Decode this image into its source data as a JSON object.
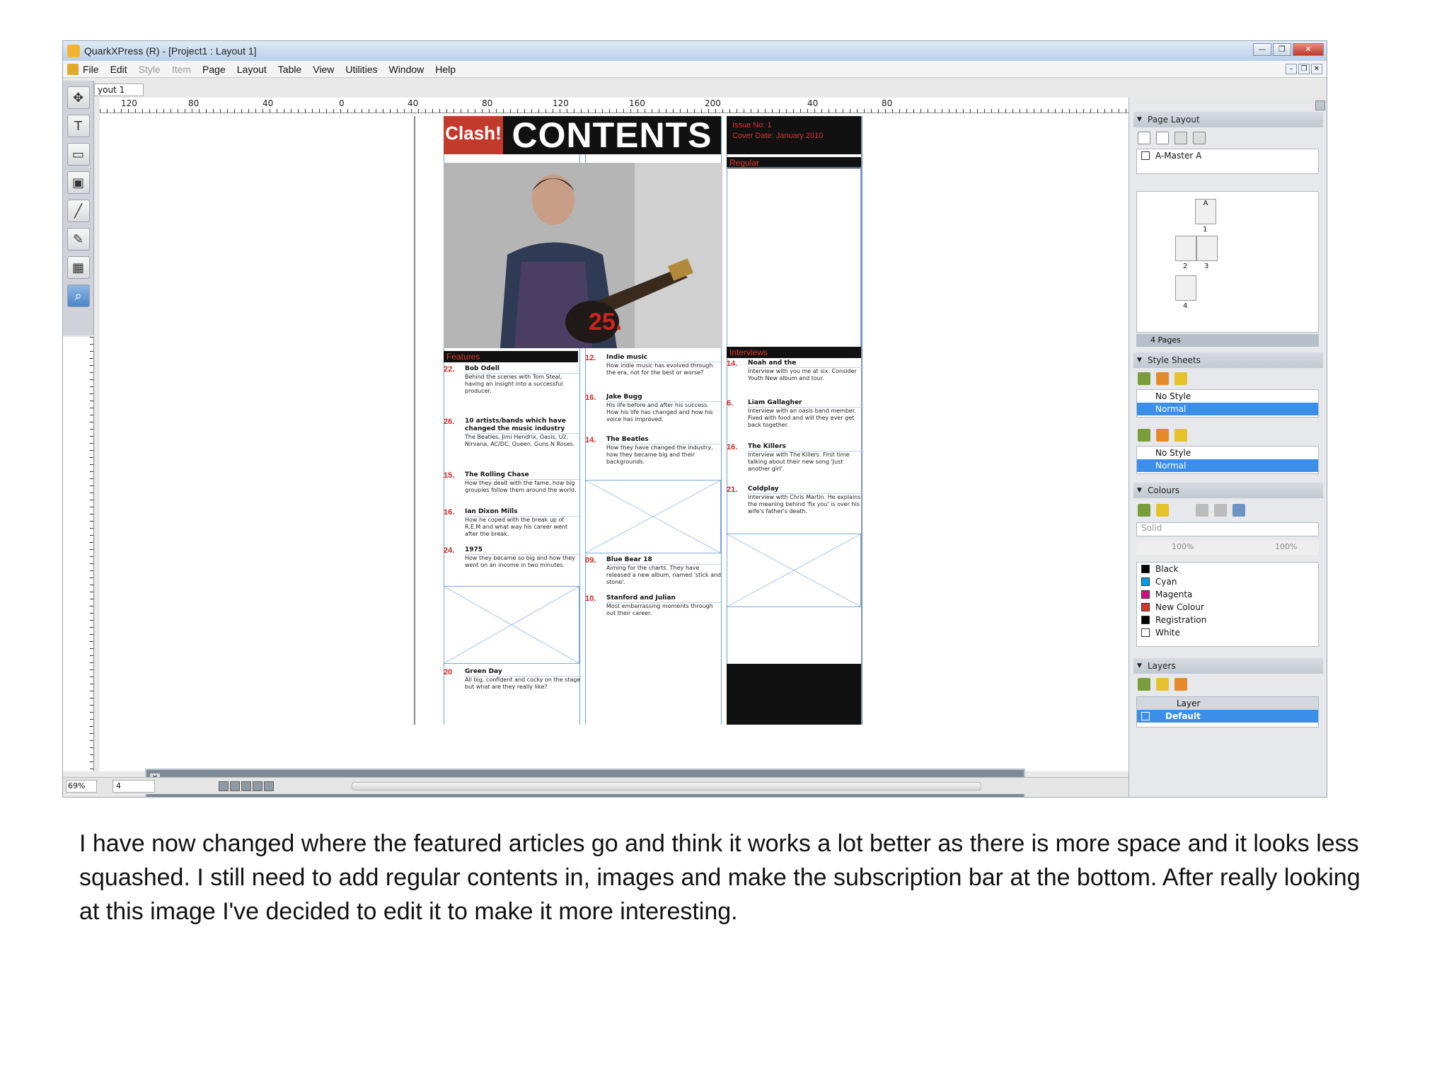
{
  "window": {
    "title": "QuarkXPress (R) - [Project1 : Layout 1]",
    "controls": [
      "—",
      "❐",
      "✕"
    ]
  },
  "menu": [
    {
      "label": "File",
      "enabled": true
    },
    {
      "label": "Edit",
      "enabled": true
    },
    {
      "label": "Style",
      "enabled": false
    },
    {
      "label": "Item",
      "enabled": false
    },
    {
      "label": "Page",
      "enabled": true
    },
    {
      "label": "Layout",
      "enabled": true
    },
    {
      "label": "Table",
      "enabled": true
    },
    {
      "label": "View",
      "enabled": true
    },
    {
      "label": "Utilities",
      "enabled": true
    },
    {
      "label": "Window",
      "enabled": true
    },
    {
      "label": "Help",
      "enabled": true
    }
  ],
  "doc_tab": "yout 1",
  "ruler_h_ticks": [
    "120",
    "80",
    "40",
    "0",
    "40",
    "80",
    "120",
    "160",
    "200",
    "40",
    "80"
  ],
  "page": {
    "logo": "Clash!",
    "title": "CONTENTS",
    "issue_no": "Issue No: 1",
    "cover_date": "Cover Date: January 2010",
    "photo_number": "25.",
    "sections": {
      "features": "Features",
      "regular": "Regular",
      "interviews": "Interviews"
    }
  },
  "features": [
    {
      "num": "22.",
      "head": "Bob Odell",
      "body": "Behind the scenes with Tom Steal, having an insight into a successful producer."
    },
    {
      "num": "26.",
      "head": "10 artists/bands which have changed the music industry",
      "body": "The Beatles, Jimi Hendrix, Oasis, U2, Nirvana, AC/DC, Queen, Guns N Roses."
    },
    {
      "num": "15.",
      "head": "The Rolling Chase",
      "body": "How they dealt with the fame, how big groupies follow them around the world."
    },
    {
      "num": "16.",
      "head": "Ian Dixon Mills",
      "body": "How he coped with the break up of R.E.M and what way his career went after the break."
    },
    {
      "num": "24.",
      "head": "1975",
      "body": "How they became so big and how they went on an income in two minutes."
    },
    {
      "num": "20",
      "head": "Green Day",
      "body": "All big, confident and cocky on the stage but what are they really like?"
    }
  ],
  "middle": [
    {
      "num": "12.",
      "head": "Indie music",
      "body": "How indie music has evolved through the era, not for the best or worse?"
    },
    {
      "num": "16.",
      "head": "Jake Bugg",
      "body": "His life before and after his success. How his life has changed and how his voice has improved."
    },
    {
      "num": "14.",
      "head": "The Beatles",
      "body": "How they have changed the industry, how they became big and their backgrounds."
    },
    {
      "num": "09.",
      "head": "Blue Bear 18",
      "body": "Aiming for the charts. They have released a new album, named 'stick and stone'."
    },
    {
      "num": "10.",
      "head": "Stanford and Julian",
      "body": "Most embarrassing moments through out their career."
    }
  ],
  "interviews": [
    {
      "num": "14.",
      "head": "Noah and the",
      "body": "Interview with you me at six. Consider Youth New album and tour."
    },
    {
      "num": "6.",
      "head": "Liam Gallagher",
      "body": "Interview with an oasis band member. Fixed with food and will they ever get back together."
    },
    {
      "num": "16.",
      "head": "The Killers",
      "body": "Interview with The Killers. First time talking about their new song 'Just another girl'."
    },
    {
      "num": "21.",
      "head": "Coldplay",
      "body": "Interview with Chris Martin. He explains the meaning behind 'fix you' is over his wife's father's death."
    }
  ],
  "status": {
    "zoom": "69%",
    "page": "4"
  },
  "palettes": {
    "page_layout": {
      "title": "Page Layout",
      "master": "A-Master A",
      "pages_count": "4 Pages"
    },
    "style_sheets": {
      "title": "Style Sheets",
      "para": [
        "No Style",
        "Normal"
      ],
      "char": [
        "No Style",
        "Normal"
      ]
    },
    "colours": {
      "title": "Colours",
      "fill": "Solid",
      "shade": "100%",
      "opacity": "100%",
      "items": [
        {
          "name": "Black",
          "color": "#000000"
        },
        {
          "name": "Cyan",
          "color": "#00a0e0"
        },
        {
          "name": "Magenta",
          "color": "#d0117d"
        },
        {
          "name": "New Colour",
          "color": "#d8362a"
        },
        {
          "name": "Registration",
          "color": "#000000"
        },
        {
          "name": "White",
          "color": "#ffffff"
        }
      ]
    },
    "layers": {
      "title": "Layers",
      "header": "Layer",
      "default": "Default"
    }
  },
  "caption": "I have now changed where the featured articles go and think it works a lot better as there is more space and it looks less squashed. I still need to add regular contents in, images and make the subscription bar at the bottom. After really looking at this image I've decided to edit it to make it more interesting."
}
